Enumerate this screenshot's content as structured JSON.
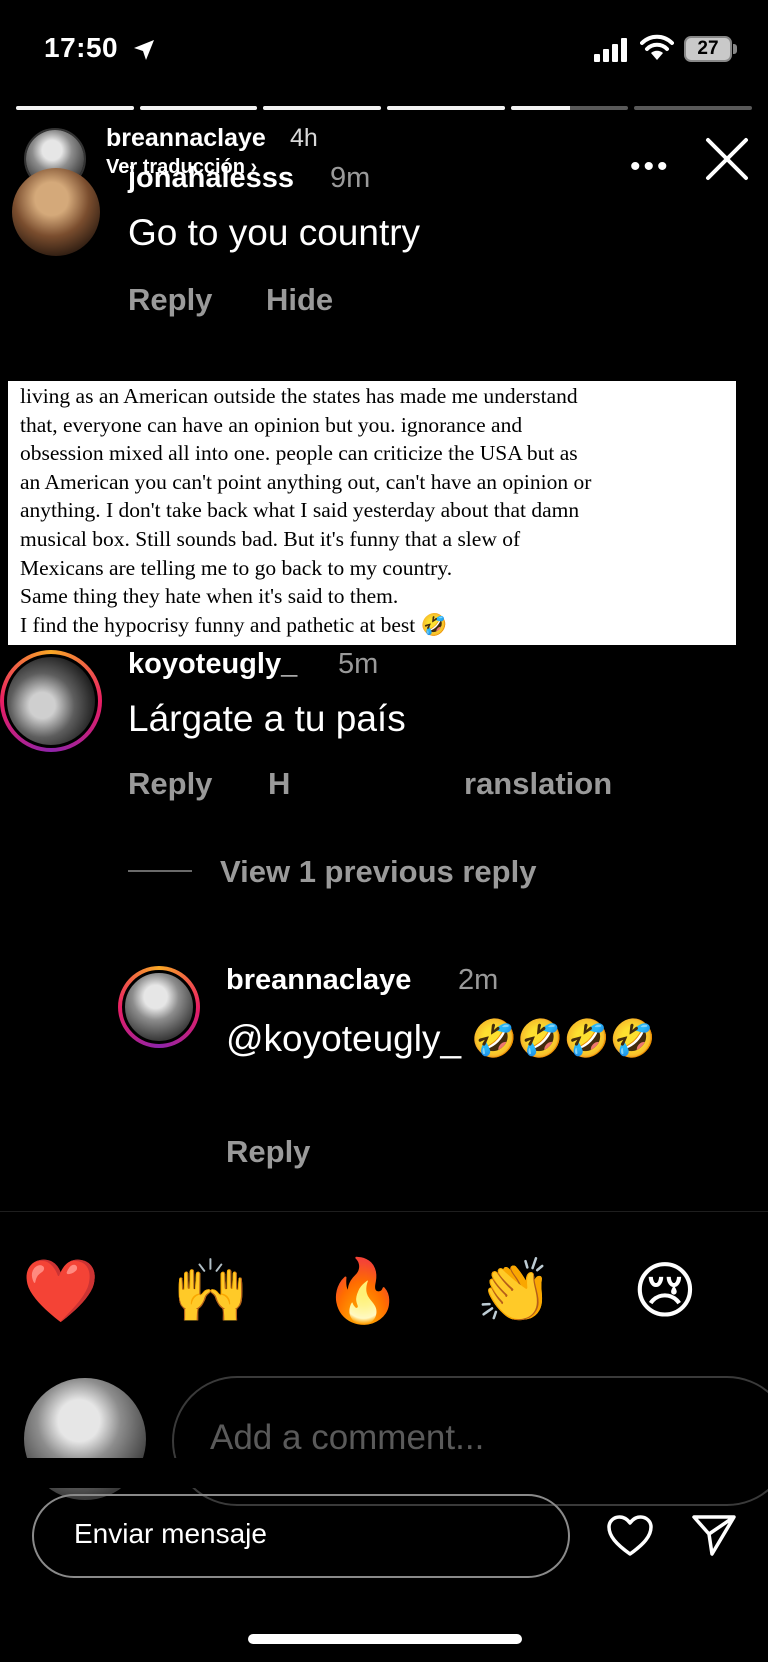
{
  "status_bar": {
    "time": "17:50",
    "battery": "27"
  },
  "story": {
    "progress": [
      1,
      1,
      1,
      1,
      0.5,
      0
    ],
    "username": "breannaclaye",
    "posted": "4h",
    "translate_label": "Ver traducción ›"
  },
  "comment1": {
    "username": "jonahalesss",
    "time": "9m",
    "text": "Go to you country",
    "reply": "Reply",
    "hide": "Hide"
  },
  "note": {
    "text": "living as an American outside the states has made me understand\nthat, everyone can have an opinion but you. ignorance and\nobsession mixed all into one. people can criticize the USA but as\nan American you can't point anything out, can't have an opinion or\nanything. I don't take back what I said yesterday about that damn\nmusical box. Still sounds bad. But it's funny that a slew of\nMexicans are telling me to go back to my country.\nSame thing they hate when it's said to them.\nI find the hypocrisy funny and pathetic at best 🤣"
  },
  "comment2": {
    "username": "koyoteugly_",
    "time": "5m",
    "text": "Lárgate a tu país",
    "reply": "Reply",
    "hide_fragment": "H",
    "translation_fragment": "ranslation",
    "view_replies": "View 1 previous reply"
  },
  "reply1": {
    "username": "breannaclaye",
    "time": "2m",
    "text": "@koyoteugly_ 🤣🤣🤣🤣",
    "reply": "Reply"
  },
  "reactions": [
    "❤️",
    "🙌",
    "🔥",
    "👏",
    "😢"
  ],
  "add_comment": {
    "placeholder": "Add a comment..."
  },
  "message": {
    "placeholder": "Enviar mensaje"
  }
}
